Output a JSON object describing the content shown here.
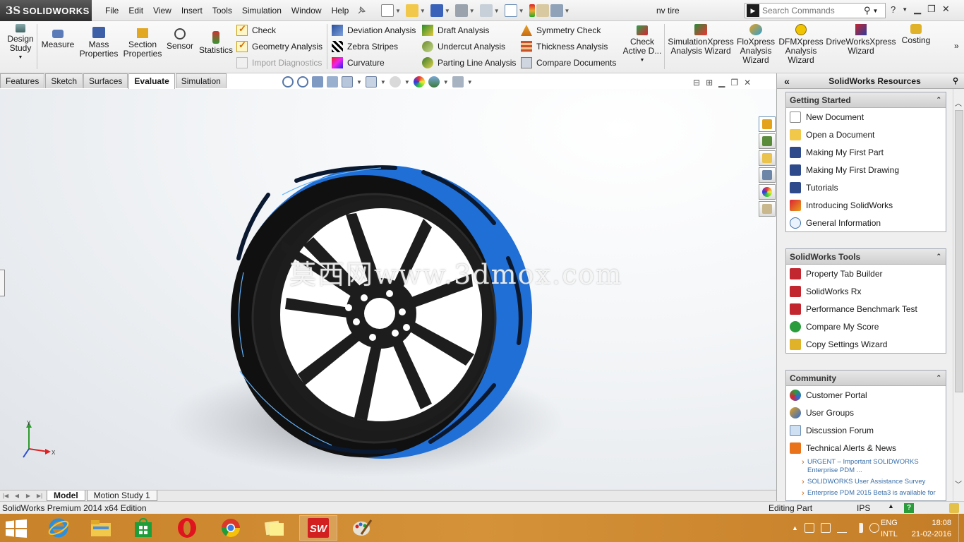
{
  "app": {
    "brand": "SOLIDWORKS",
    "brand_mark": "3S",
    "document_title": "nv tire",
    "menu": [
      "File",
      "Edit",
      "View",
      "Insert",
      "Tools",
      "Simulation",
      "Window",
      "Help"
    ],
    "search_placeholder": "Search Commands"
  },
  "ribbon": {
    "large_buttons": [
      {
        "label": "Design\nStudy",
        "icon": "design-study-icon"
      },
      {
        "label": "Measure",
        "icon": "measure-icon"
      },
      {
        "label": "Mass\nProperties",
        "icon": "mass-properties-icon"
      },
      {
        "label": "Section\nProperties",
        "icon": "section-properties-icon"
      },
      {
        "label": "Sensor",
        "icon": "sensor-icon"
      },
      {
        "label": "Statistics",
        "icon": "statistics-icon"
      }
    ],
    "check_column": [
      "Check",
      "Geometry Analysis",
      "Import Diagnostics"
    ],
    "analysis_column": [
      "Deviation Analysis",
      "Zebra Stripes",
      "Curvature"
    ],
    "draft_column": [
      "Draft Analysis",
      "Undercut Analysis",
      "Parting Line Analysis"
    ],
    "symmetry_column": [
      "Symmetry Check",
      "Thickness Analysis",
      "Compare Documents"
    ],
    "check_active": "Check\nActive D...",
    "wizards": [
      "SimulationXpress\nAnalysis Wizard",
      "FloXpress\nAnalysis\nWizard",
      "DFMXpress\nAnalysis\nWizard",
      "DriveWorksXpress\nWizard",
      "Costing"
    ]
  },
  "tabs": [
    "Features",
    "Sketch",
    "Surfaces",
    "Evaluate",
    "Simulation"
  ],
  "active_tab": "Evaluate",
  "viewport": {
    "watermark": "莫西网www.3dmox.com",
    "axis_x": "X",
    "axis_y": "Y",
    "tire_color": "#1f6fd6",
    "rim_color": "#1c1c1c"
  },
  "resources": {
    "title": "SolidWorks Resources",
    "getting_started": {
      "title": "Getting Started",
      "items": [
        "New Document",
        "Open a Document",
        "Making My First Part",
        "Making My First Drawing",
        "Tutorials",
        "Introducing SolidWorks",
        "General Information"
      ]
    },
    "tools": {
      "title": "SolidWorks Tools",
      "items": [
        "Property Tab Builder",
        "SolidWorks Rx",
        "Performance Benchmark Test",
        "Compare My Score",
        "Copy Settings Wizard"
      ]
    },
    "community": {
      "title": "Community",
      "items": [
        "Customer Portal",
        "User Groups",
        "Discussion Forum",
        "Technical Alerts & News"
      ],
      "news": [
        "URGENT – Important SOLIDWORKS Enterprise PDM ...",
        "SOLIDWORKS User Assistance Survey",
        "Enterprise PDM 2015 Beta3 is available for"
      ]
    }
  },
  "model_tabs": [
    "Model",
    "Motion Study 1"
  ],
  "status": {
    "edition": "SolidWorks Premium 2014 x64 Edition",
    "mode": "Editing Part",
    "units": "IPS",
    "help": "?"
  },
  "taskbar": {
    "apps": [
      "internet-explorer-icon",
      "file-explorer-icon",
      "store-icon",
      "opera-icon",
      "chrome-icon",
      "sticky-notes-icon",
      "solidworks-icon",
      "paint-icon"
    ],
    "active_app": "solidworks-icon",
    "language": "ENG",
    "keyboard": "INTL",
    "time": "18:08",
    "date": "21-02-2016"
  }
}
